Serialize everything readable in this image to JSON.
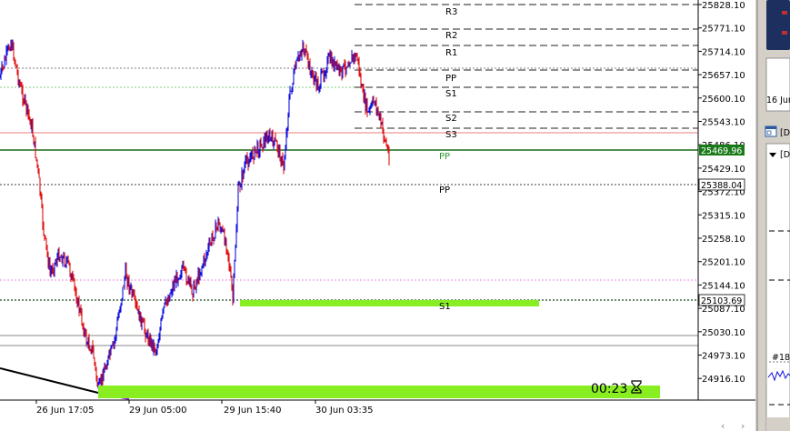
{
  "colors": {
    "bull": "#1010e0",
    "bear": "#e01010",
    "resistance_line": "#202020",
    "pp_green": "#2a9a2a",
    "current_bg": "#1a7a1a",
    "zone_green": "#88ee22",
    "trend_line": "#000000",
    "side_panel_blue": "#1c2f5e",
    "panel_gray": "#d4d0c8"
  },
  "price_scale": {
    "labels": [
      "25828.10",
      "25771.10",
      "25714.10",
      "25657.10",
      "25600.10",
      "25543.10",
      "25486.10",
      "25429.10",
      "25372.10",
      "25315.10",
      "25258.10",
      "25201.10",
      "25144.10",
      "25087.10",
      "25030.10",
      "24973.10",
      "24916.10"
    ],
    "current_price": "25469.96",
    "secondary_price": "25388.04",
    "support_price": "25103.69"
  },
  "time_axis": {
    "labels": [
      "26 Jun 17:05",
      "29 Jun 05:00",
      "29 Jun 15:40",
      "30 Jun 03:35"
    ]
  },
  "levels": [
    {
      "label": "R3",
      "kind": "dash"
    },
    {
      "label": "R2",
      "kind": "dash"
    },
    {
      "label": "R1",
      "kind": "dash"
    },
    {
      "label": "PP",
      "kind": "dash"
    },
    {
      "label": "S1",
      "kind": "dash"
    },
    {
      "label": "S2",
      "kind": "dash"
    },
    {
      "label": "S3",
      "kind": "dash"
    },
    {
      "label": "PP",
      "kind": "green"
    },
    {
      "label": "PP",
      "kind": "dotted"
    },
    {
      "label": "S1",
      "kind": "zone"
    }
  ],
  "timer": {
    "text": "00:23",
    "icon": "hourglass-icon"
  },
  "side_panel": {
    "date_label": "16 Jun",
    "dropdown_label": "[D",
    "order_label": "#18",
    "icons": [
      "window-icon",
      "chevron-down-icon"
    ]
  },
  "scroll": {
    "left_arrow": "‹",
    "right_arrow": "›"
  }
}
